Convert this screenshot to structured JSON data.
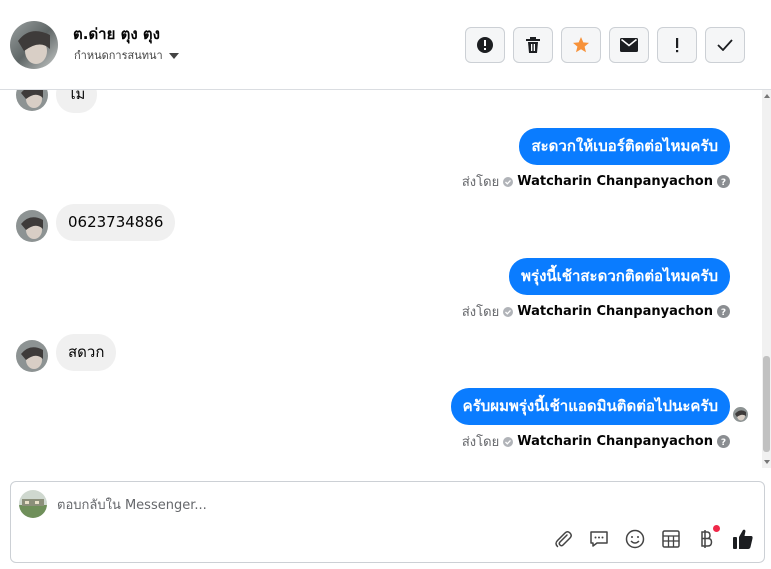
{
  "header": {
    "contact_name": "ต.ด่าย ตุง ตุง",
    "assign_label": "กำหนดการสนทนา",
    "actions": [
      {
        "name": "report-button",
        "icon": "alert-circle-icon"
      },
      {
        "name": "delete-button",
        "icon": "trash-icon"
      },
      {
        "name": "star-button",
        "icon": "star-icon"
      },
      {
        "name": "mark-unread-button",
        "icon": "envelope-icon"
      },
      {
        "name": "priority-button",
        "icon": "exclamation-icon"
      },
      {
        "name": "done-button",
        "icon": "check-icon"
      }
    ]
  },
  "messages": [
    {
      "direction": "in",
      "text": "ไม่"
    },
    {
      "direction": "out",
      "text": "สะดวกให้เบอร์ติดต่อไหมครับ",
      "sent_by_label": "ส่งโดย",
      "agent": "Watcharin Chanpanyachon"
    },
    {
      "direction": "in",
      "text": "0623734886"
    },
    {
      "direction": "out",
      "text": "พรุ่งนี้เช้าสะดวกติดต่อไหมครับ",
      "sent_by_label": "ส่งโดย",
      "agent": "Watcharin Chanpanyachon"
    },
    {
      "direction": "in",
      "text": "สดวก"
    },
    {
      "direction": "out",
      "text": "ครับผมพรุ่งนี้เช้าแอดมินติดต่อไปนะครับ",
      "sent_by_label": "ส่งโดย",
      "agent": "Watcharin Chanpanyachon"
    }
  ],
  "composer": {
    "placeholder": "ตอบกลับใน Messenger...",
    "value": "",
    "tools": [
      "paperclip-icon",
      "saved-reply-icon",
      "emoji-icon",
      "table-icon",
      "baht-icon",
      "thumbs-up-icon"
    ]
  },
  "colors": {
    "outgoing_bubble": "#0a7cff",
    "incoming_bubble": "#f0f0f0",
    "star": "#f7923a",
    "notification_dot": "#f02849"
  }
}
